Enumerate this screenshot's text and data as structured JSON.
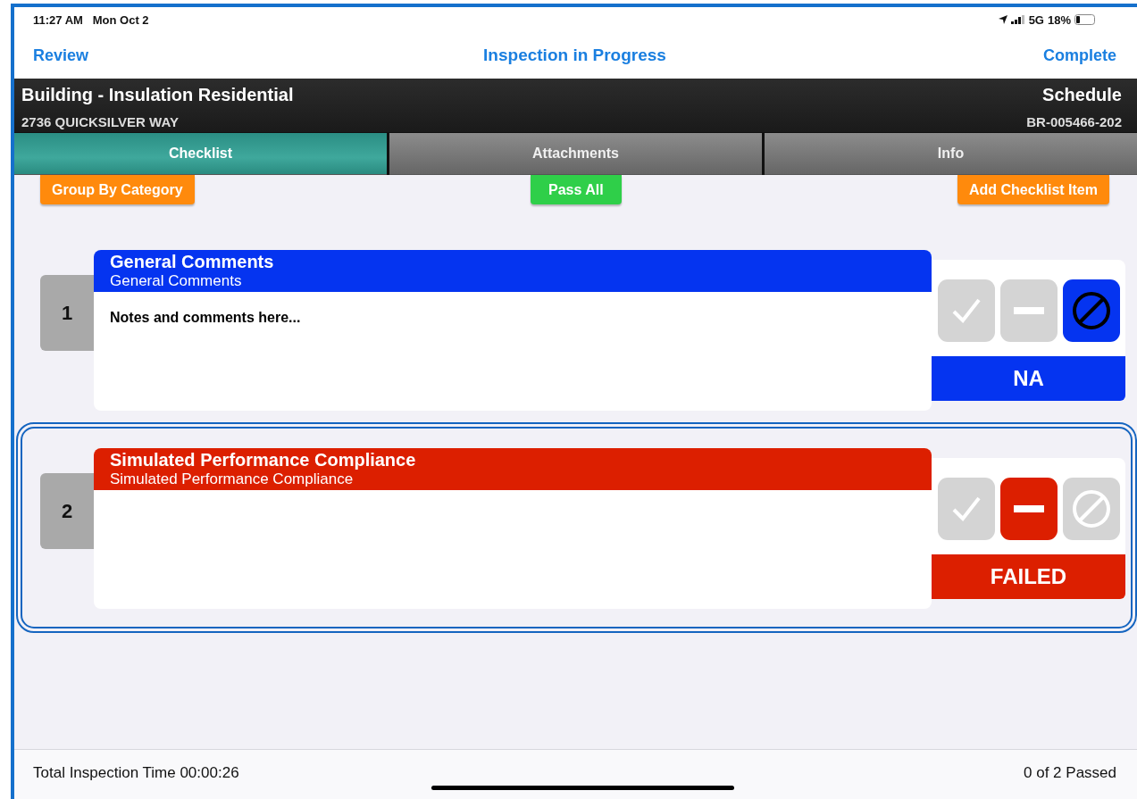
{
  "status_bar": {
    "time": "11:27 AM",
    "date": "Mon Oct 2",
    "network": "5G",
    "battery": "18%"
  },
  "nav": {
    "left": "Review",
    "title": "Inspection in Progress",
    "right": "Complete"
  },
  "header": {
    "title": "Building - Insulation Residential",
    "address": "2736 QUICKSILVER WAY",
    "status": "Schedule",
    "permit": "BR-005466-202"
  },
  "tabs": [
    {
      "label": "Checklist",
      "selected": true
    },
    {
      "label": "Attachments",
      "selected": false
    },
    {
      "label": "Info",
      "selected": false
    }
  ],
  "toolbar": [
    {
      "label": "Group By Category",
      "kind": "orange"
    },
    {
      "label": "Pass All",
      "kind": "green"
    },
    {
      "label": "Add Checklist Item",
      "kind": "orange"
    }
  ],
  "items": [
    {
      "number": "1",
      "title": "General Comments",
      "subtitle": "General Comments",
      "notes": "Notes and comments here...",
      "status_label": "NA",
      "selected": false,
      "results": [
        {
          "kind": "pass",
          "selected": false
        },
        {
          "kind": "fail",
          "selected": false
        },
        {
          "kind": "na",
          "selected": true
        }
      ]
    },
    {
      "number": "2",
      "title": "Simulated Performance Compliance",
      "subtitle": "Simulated Performance Compliance",
      "status_label": "FAILED",
      "selected": true,
      "results": [
        {
          "kind": "pass",
          "selected": false
        },
        {
          "kind": "fail",
          "selected": true
        },
        {
          "kind": "na",
          "selected": false
        }
      ]
    }
  ],
  "footer": {
    "time": "Total Inspection Time 00:00:26",
    "summary": "0 of 2 Passed"
  }
}
